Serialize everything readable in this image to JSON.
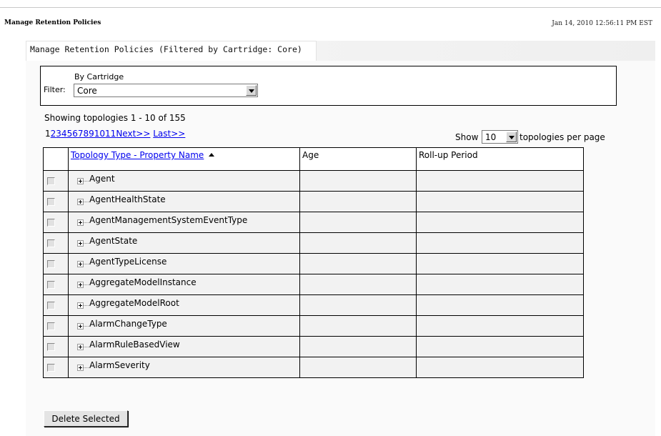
{
  "header": {
    "title": "Manage Retention Policies",
    "datetime": "Jan 14, 2010 12:56:11 PM EST"
  },
  "panel": {
    "title": "Manage Retention Policies (Filtered by Cartridge: Core)"
  },
  "filter": {
    "label": "Filter:",
    "sub_label": "By Cartridge",
    "selected": "Core"
  },
  "showing_text": "Showing topologies 1 - 10 of 155",
  "pagination": {
    "current": "1",
    "pages": [
      "2",
      "3",
      "4",
      "5",
      "6",
      "7",
      "8",
      "9",
      "10",
      "11"
    ],
    "next": "Next>>",
    "last": "Last>>"
  },
  "per_page": {
    "prefix": "Show",
    "value": "10",
    "suffix": "topologies per page"
  },
  "table": {
    "columns": [
      "Topology Type - Property Name",
      "Age",
      "Roll-up Period"
    ],
    "sort": "ascending",
    "rows": [
      {
        "name": "Agent",
        "age": "",
        "rollup": ""
      },
      {
        "name": "AgentHealthState",
        "age": "",
        "rollup": ""
      },
      {
        "name": "AgentManagementSystemEventType",
        "age": "",
        "rollup": ""
      },
      {
        "name": "AgentState",
        "age": "",
        "rollup": ""
      },
      {
        "name": "AgentTypeLicense",
        "age": "",
        "rollup": ""
      },
      {
        "name": "AggregateModelInstance",
        "age": "",
        "rollup": ""
      },
      {
        "name": "AggregateModelRoot",
        "age": "",
        "rollup": ""
      },
      {
        "name": "AlarmChangeType",
        "age": "",
        "rollup": ""
      },
      {
        "name": "AlarmRuleBasedView",
        "age": "",
        "rollup": ""
      },
      {
        "name": "AlarmSeverity",
        "age": "",
        "rollup": ""
      }
    ]
  },
  "actions": {
    "delete_label": "Delete Selected"
  }
}
